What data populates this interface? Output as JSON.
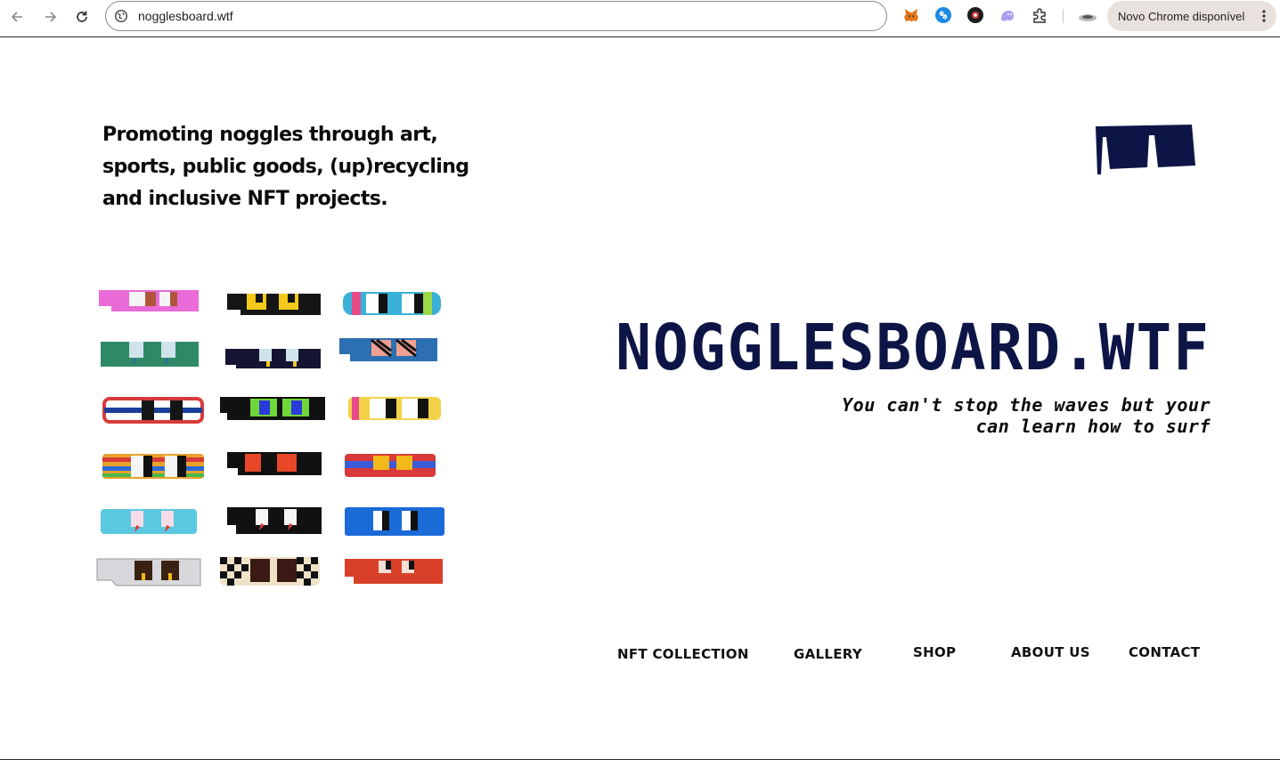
{
  "browser": {
    "url": "nogglesboard.wtf",
    "update_label": "Novo Chrome disponível",
    "extensions": [
      "metamask-icon",
      "shazam-icon",
      "wallet-icon",
      "ghost-icon",
      "puzzle-icon"
    ]
  },
  "hero": {
    "tagline": "Promoting noggles through art, sports, public goods, (up)recycling and inclusive NFT projects.",
    "title": "NOGGLESBOARD.WTF",
    "motto_line1": "You can't stop the waves but your",
    "motto_line2": "can learn how to surf"
  },
  "nav": {
    "items": [
      "NFT COLLECTION",
      "GALLERY",
      "SHOP",
      "ABOUT US",
      "CONTACT"
    ]
  },
  "colors": {
    "brand_navy": "#0d1547",
    "text": "#0b0b0b"
  }
}
